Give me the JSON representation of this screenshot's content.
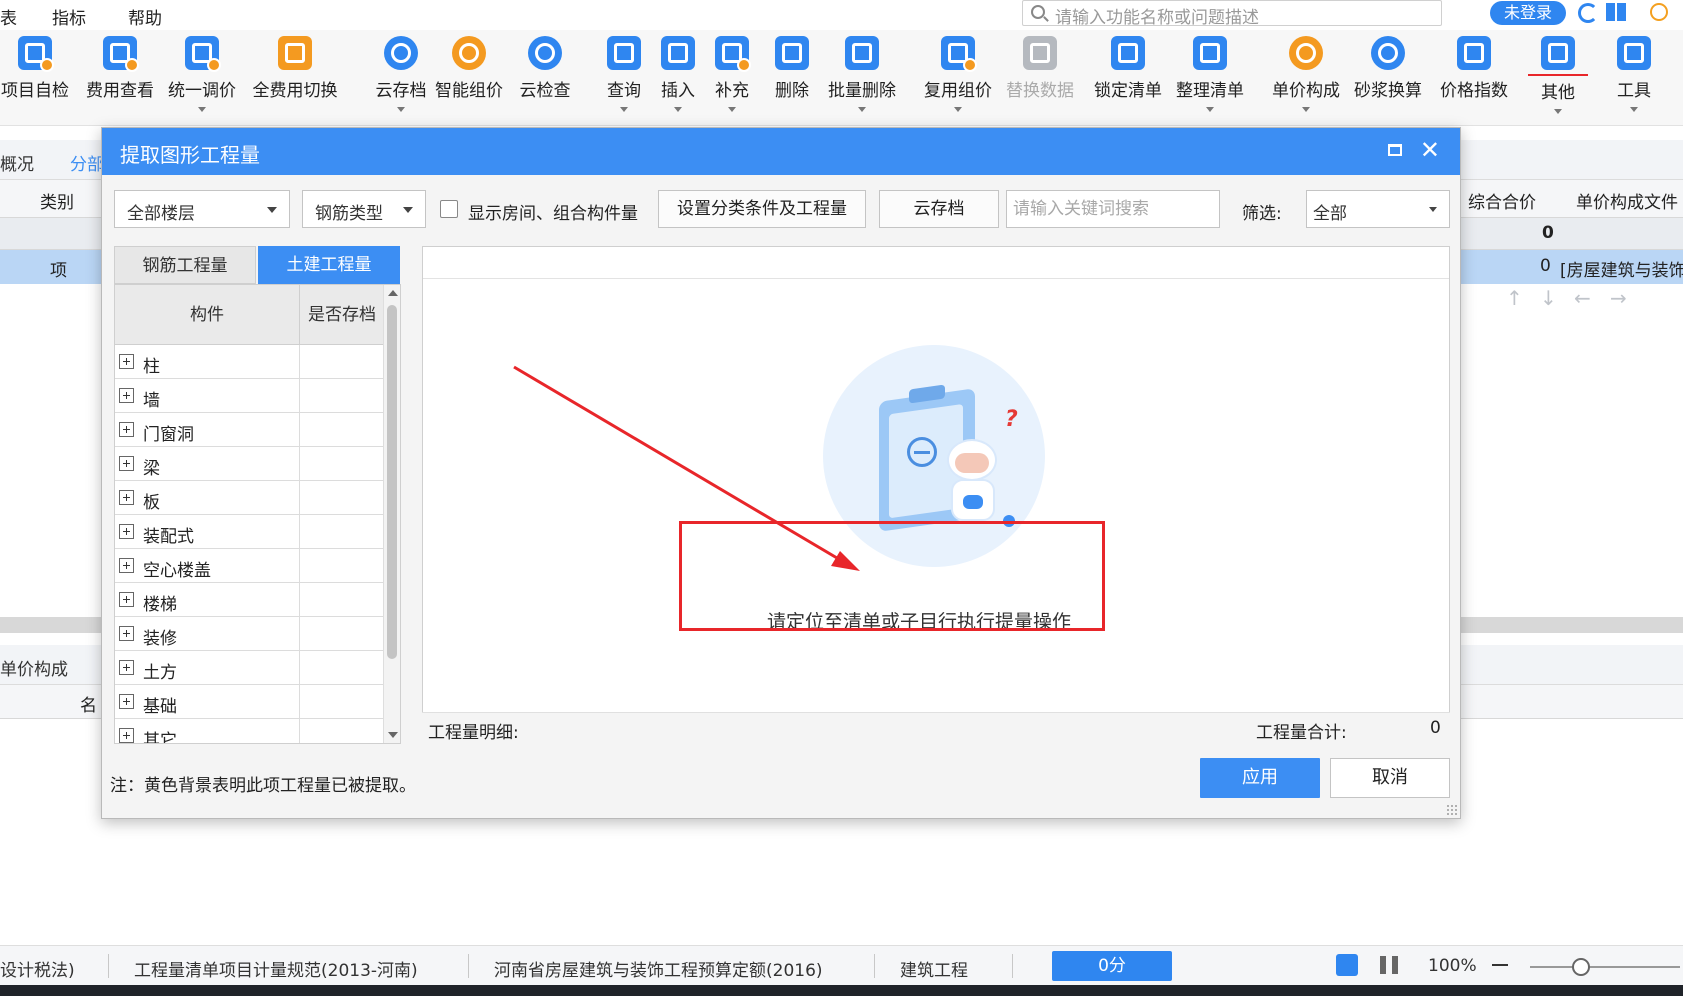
{
  "menubar": {
    "items": [
      "表",
      "指标",
      "帮助"
    ],
    "search_placeholder": "请输入功能名称或问题描述",
    "login_label": "未登录"
  },
  "ribbon": {
    "buttons": [
      {
        "label": "项目自检",
        "icon": "checklist-icon"
      },
      {
        "label": "费用查看",
        "icon": "cost-view-icon"
      },
      {
        "label": "统一调价",
        "icon": "price-adjust-icon"
      },
      {
        "label": "全费用切换",
        "icon": "full-cost-switch-icon"
      },
      {
        "label": "云存档",
        "icon": "cloud-upload-icon"
      },
      {
        "label": "智能组价",
        "icon": "smart-price-icon"
      },
      {
        "label": "云检查",
        "icon": "cloud-check-icon"
      },
      {
        "label": "查询",
        "icon": "query-icon"
      },
      {
        "label": "插入",
        "icon": "insert-icon"
      },
      {
        "label": "补充",
        "icon": "supplement-icon"
      },
      {
        "label": "删除",
        "icon": "delete-icon"
      },
      {
        "label": "批量删除",
        "icon": "batch-delete-icon"
      },
      {
        "label": "复用组价",
        "icon": "reuse-price-icon"
      },
      {
        "label": "替换数据",
        "icon": "replace-data-icon"
      },
      {
        "label": "锁定清单",
        "icon": "lock-icon"
      },
      {
        "label": "整理清单",
        "icon": "organize-list-icon"
      },
      {
        "label": "单价构成",
        "icon": "unit-price-icon"
      },
      {
        "label": "砂浆换算",
        "icon": "mortar-convert-icon"
      },
      {
        "label": "价格指数",
        "icon": "price-index-icon"
      },
      {
        "label": "其他",
        "icon": "other-icon"
      },
      {
        "label": "工具",
        "icon": "tools-icon"
      }
    ]
  },
  "background": {
    "tab_left": "概况",
    "tab_fenbu": "分部",
    "col_category": "类别",
    "col_total": "综合合价",
    "col_unit_file": "单价构成文件",
    "sum_value": "0",
    "row_type": "项",
    "row_total": "0",
    "row_unit_file": "[房屋建筑与装饰",
    "lower_tab": "单价构成",
    "lower_col_name": "名"
  },
  "dialog": {
    "title": "提取图形工程量",
    "floor_select": "全部楼层",
    "rebar_select": "钢筋类型",
    "show_room_label": "显示房间、组合构件量",
    "set_condition_btn": "设置分类条件及工程量",
    "cloud_btn": "云存档",
    "keyword_placeholder": "请输入关键词搜索",
    "filter_label": "筛选:",
    "filter_value": "全部",
    "tabs": [
      "钢筋工程量",
      "土建工程量"
    ],
    "tree_headers": [
      "构件",
      "是否存档"
    ],
    "tree_items": [
      "柱",
      "墙",
      "门窗洞",
      "梁",
      "板",
      "装配式",
      "空心楼盖",
      "楼梯",
      "装修",
      "土方",
      "基础",
      "其它"
    ],
    "empty_message": "请定位至清单或子目行执行提量操作",
    "detail_label": "工程量明细:",
    "total_label": "工程量合计:",
    "total_value": "0",
    "note": "注：黄色背景表明此项工程量已被提取。",
    "apply_btn": "应用",
    "cancel_btn": "取消"
  },
  "statusbar": {
    "tax": "设计税法)",
    "spec": "工程量清单项目计量规范(2013-河南)",
    "quota": "河南省房屋建筑与装饰工程预算定额(2016)",
    "type": "建筑工程",
    "score": "0分",
    "zoom": "100%"
  },
  "colors": {
    "accent": "#3c8ef3",
    "annotation": "#e8262a",
    "selected_row": "#bad6f5"
  }
}
